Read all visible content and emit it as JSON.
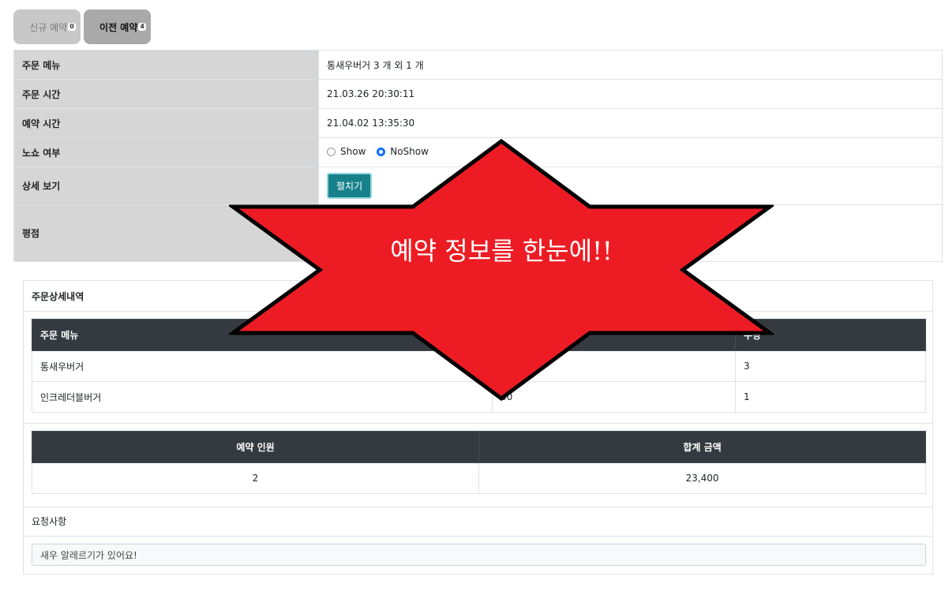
{
  "tabs": [
    {
      "label": "신규 예약",
      "count": "0"
    },
    {
      "label": "이전 예약",
      "count": "4"
    }
  ],
  "info": {
    "menu_label": "주문 메뉴",
    "menu_value": "통새우버거 3 개 외 1 개",
    "order_time_label": "주문 시간",
    "order_time_value": "21.03.26 20:30:11",
    "reserve_time_label": "예약 시간",
    "reserve_time_value": "21.04.02 13:35:30",
    "noshow_label": "노쇼 여부",
    "radio_show": "Show",
    "radio_noshow": "NoShow",
    "radio_selected": "NoShow",
    "detail_label": "상세 보기",
    "detail_button": "펼치기",
    "rating_label": "평점"
  },
  "detail": {
    "header": "주문상세내역",
    "menu_table": {
      "columns": [
        "주문 메뉴",
        "",
        "수량"
      ],
      "rows": [
        [
          "통새우버거",
          "",
          "3"
        ],
        [
          "인크레더블버거",
          "00",
          "1"
        ]
      ]
    },
    "summary": {
      "columns": [
        "예약 인원",
        "합계 금액"
      ],
      "values": [
        "2",
        "23,400"
      ]
    },
    "request_label": "요청사항",
    "request_value": "새우 알레르기가 있어요!"
  },
  "banner": {
    "text": "예약 정보를 한눈에!!",
    "fill": "#ed1c24"
  }
}
